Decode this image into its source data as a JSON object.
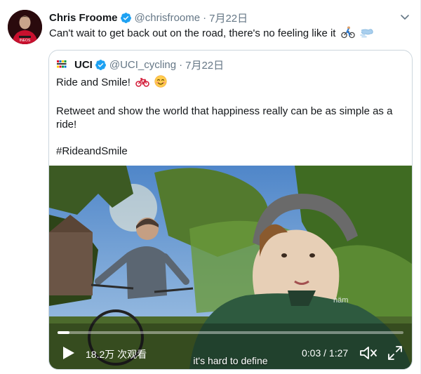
{
  "tweet": {
    "author_name": "Chris Froome",
    "handle": "@chrisfroome",
    "separator": "·",
    "date": "7月22日",
    "text": "Can't wait to get back out on the road, there's no feeling like it",
    "avatar_icon": "avatar-photo",
    "caret_icon": "chevron-down-icon"
  },
  "quote": {
    "author_name": "UCI",
    "handle": "@UCI_cycling",
    "separator": "·",
    "date": "7月22日",
    "line1": "Ride and Smile!",
    "line2": "Retweet and show the world that happiness really can be as simple as a ride!",
    "hashtag": "#RideandSmile"
  },
  "video": {
    "views": "18.2万 次观看",
    "time": "0:03 / 1:27",
    "caption": "it's hard to define",
    "progress": 0.035
  },
  "colors": {
    "verified": "#1da1f2",
    "muted": "#657786",
    "border": "#ccd6dd"
  }
}
